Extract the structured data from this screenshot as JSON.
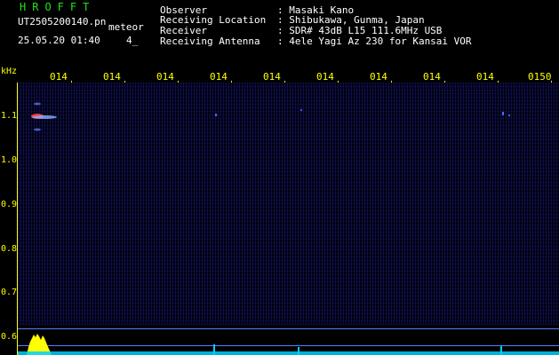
{
  "header": {
    "logo": "HROFFT",
    "filename": "UT2505200140.pn",
    "mode": "meteor",
    "datetime": "25.05.20 01:40",
    "channel": "4_",
    "observer_label": "Observer",
    "observer_value": ": Masaki Kano",
    "location_label": "Receiving Location",
    "location_value": ": Shibukawa, Gunma, Japan",
    "receiver_label": "Receiver",
    "receiver_value": ": SDR# 43dB L15 111.6MHz USB",
    "antenna_label": "Receiving Antenna",
    "antenna_value": ": 4ele Yagi Az 230 for Kansai VOR"
  },
  "axes": {
    "y_unit": "kHz",
    "x_ticks": [
      "014",
      "014",
      "014",
      "014",
      "014",
      "014",
      "014",
      "014",
      "014",
      "0150"
    ],
    "y_ticks": [
      "1.1",
      "1.0",
      "0.9",
      "0.8",
      "0.7",
      "0.6"
    ]
  },
  "colors": {
    "label": "#ffff00",
    "logo": "#19e619",
    "background": "#000010",
    "echo": "#ff4040",
    "baseline": "#5080ff",
    "strength": "#00d0ff"
  }
}
